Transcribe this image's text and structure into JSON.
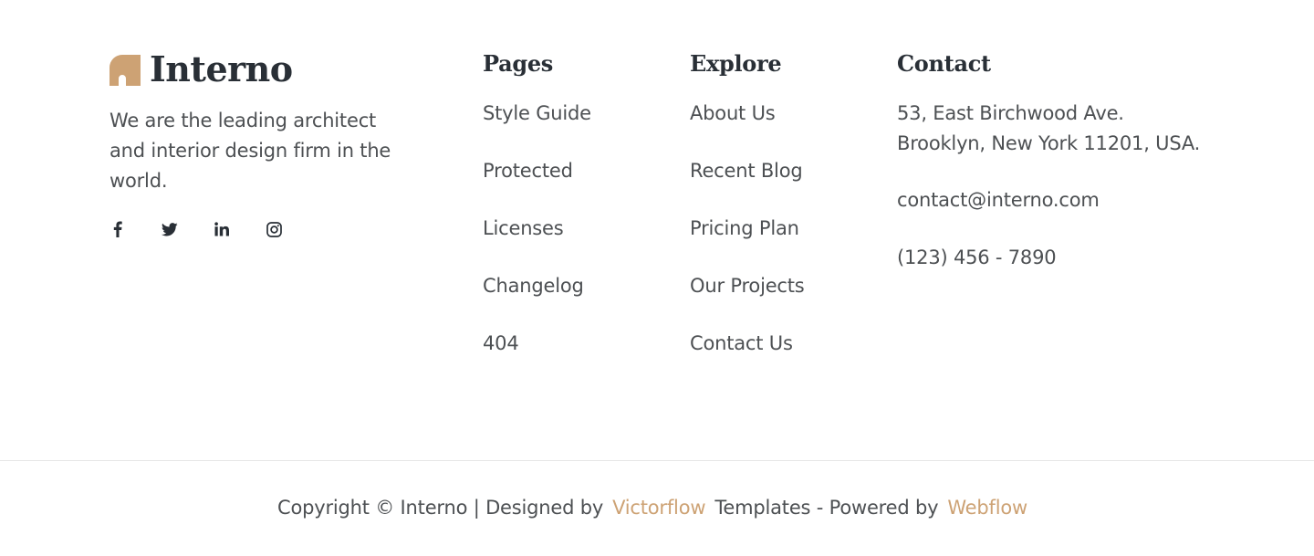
{
  "brand": {
    "name": "Interno",
    "tagline": "We are the leading architect and interior design firm in the world.",
    "accent_color": "#cda274",
    "socials": [
      {
        "icon": "facebook-icon"
      },
      {
        "icon": "twitter-icon"
      },
      {
        "icon": "linkedin-icon"
      },
      {
        "icon": "instagram-icon"
      }
    ]
  },
  "pages": {
    "title": "Pages",
    "links": [
      "Style Guide",
      "Protected",
      "Licenses",
      "Changelog",
      "404"
    ]
  },
  "explore": {
    "title": "Explore",
    "links": [
      "About Us",
      "Recent Blog",
      "Pricing Plan",
      "Our Projects",
      "Contact Us"
    ]
  },
  "contact": {
    "title": "Contact",
    "address_line1": "53, East Birchwood Ave.",
    "address_line2": "Brooklyn, New York 11201, USA.",
    "email": "contact@interno.com",
    "phone": "(123) 456 - 7890"
  },
  "copyright": {
    "prefix": "Copyright © Interno | Designed by",
    "designer": "Victorflow",
    "middle": "Templates - Powered by",
    "platform": "Webflow"
  }
}
